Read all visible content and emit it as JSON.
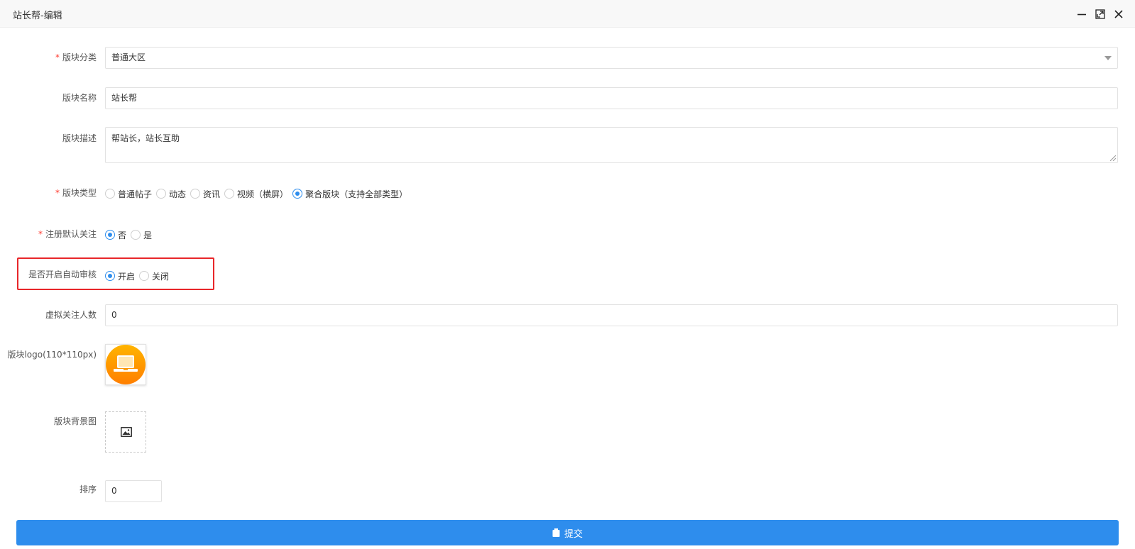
{
  "window": {
    "title": "站长帮-编辑",
    "controls": {
      "minimize": "minimize-icon",
      "maximize": "maximize-icon",
      "close": "close-icon"
    }
  },
  "form": {
    "category": {
      "label": "版块分类",
      "required_mark": "*",
      "value": "普通大区"
    },
    "name": {
      "label": "版块名称",
      "value": "站长帮"
    },
    "description": {
      "label": "版块描述",
      "value": "帮站长，站长互助"
    },
    "type": {
      "label": "版块类型",
      "required_mark": "*",
      "options": [
        "普通帖子",
        "动态",
        "资讯",
        "视频（横屏）",
        "聚合版块（支持全部类型）"
      ],
      "selected": "聚合版块（支持全部类型）"
    },
    "default_follow": {
      "label": "注册默认关注",
      "required_mark": "*",
      "options": [
        "否",
        "是"
      ],
      "selected": "否"
    },
    "auto_review": {
      "label": "是否开启自动审核",
      "options": [
        "开启",
        "关闭"
      ],
      "selected": "开启"
    },
    "virtual_followers": {
      "label": "虚拟关注人数",
      "value": "0"
    },
    "logo": {
      "label": "版块logo(110*110px)",
      "icon": "laptop-logo-icon"
    },
    "background": {
      "label": "版块背景图",
      "icon": "image-placeholder-icon"
    },
    "sort": {
      "label": "排序",
      "value": "0"
    },
    "submit": {
      "label": "提交",
      "icon": "save-icon"
    }
  },
  "colors": {
    "accent": "#2e8ded",
    "required": "#ff3b30",
    "highlight": "#e8262a",
    "logo_orange": "#ff9500"
  }
}
